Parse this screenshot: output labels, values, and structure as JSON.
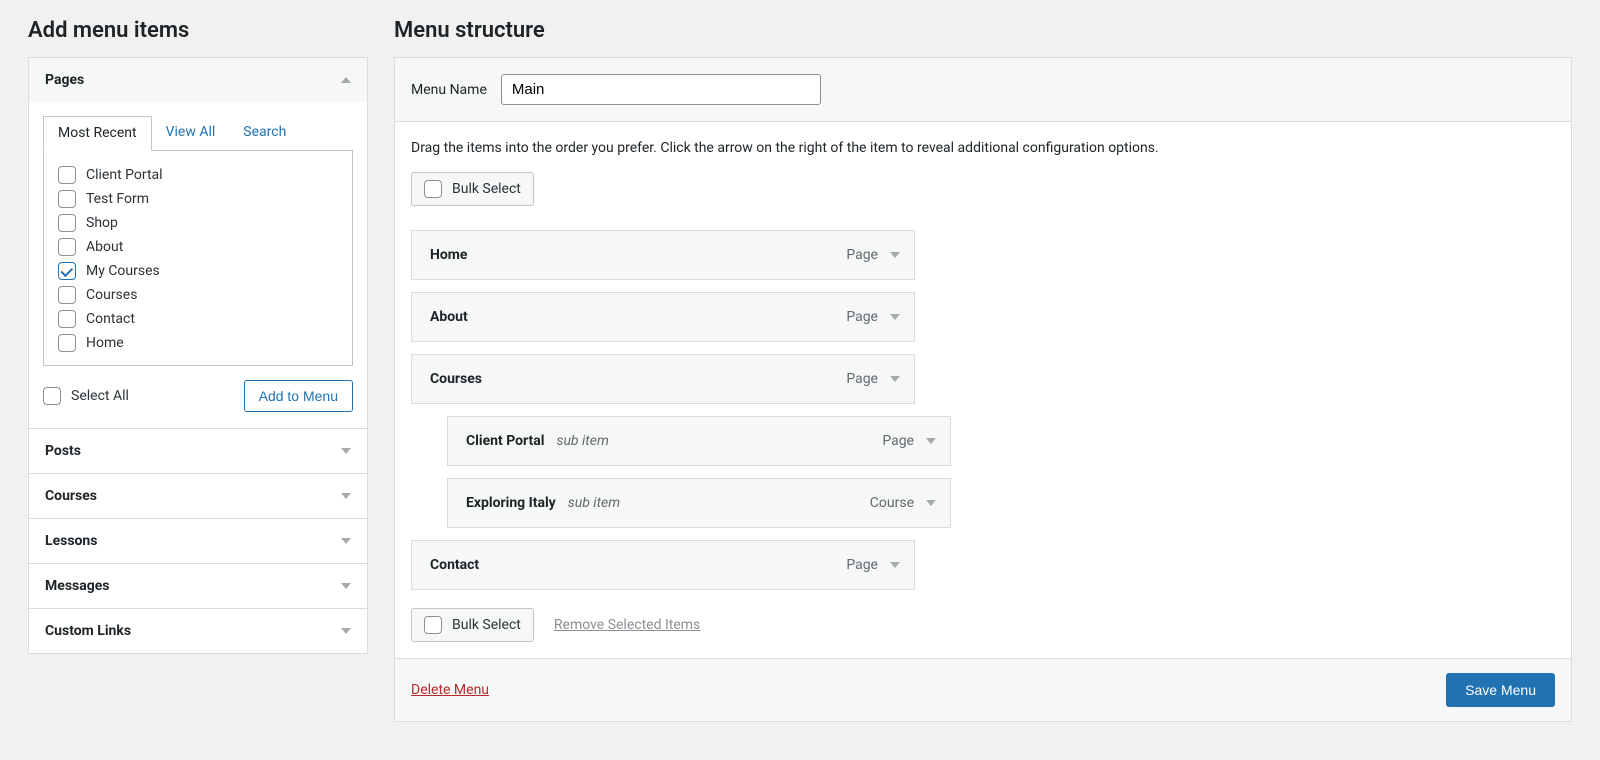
{
  "left": {
    "heading": "Add menu items",
    "sections": {
      "pages": {
        "title": "Pages",
        "tabs": {
          "recent": "Most Recent",
          "view_all": "View All",
          "search": "Search"
        },
        "items": [
          {
            "label": "Client Portal",
            "checked": false
          },
          {
            "label": "Test Form",
            "checked": false
          },
          {
            "label": "Shop",
            "checked": false
          },
          {
            "label": "About",
            "checked": false
          },
          {
            "label": "My Courses",
            "checked": true
          },
          {
            "label": "Courses",
            "checked": false
          },
          {
            "label": "Contact",
            "checked": false
          },
          {
            "label": "Home",
            "checked": false
          }
        ],
        "select_all": "Select All",
        "add_button": "Add to Menu"
      },
      "posts": "Posts",
      "courses": "Courses",
      "lessons": "Lessons",
      "messages": "Messages",
      "custom_links": "Custom Links"
    }
  },
  "right": {
    "heading": "Menu structure",
    "name_label": "Menu Name",
    "name_value": "Main",
    "hint": "Drag the items into the order you prefer. Click the arrow on the right of the item to reveal additional configuration options.",
    "bulk_label": "Bulk Select",
    "sub_label": "sub item",
    "items": [
      {
        "title": "Home",
        "type": "Page",
        "depth": 0
      },
      {
        "title": "About",
        "type": "Page",
        "depth": 0
      },
      {
        "title": "Courses",
        "type": "Page",
        "depth": 0
      },
      {
        "title": "Client Portal",
        "type": "Page",
        "depth": 1
      },
      {
        "title": "Exploring Italy",
        "type": "Course",
        "depth": 1
      },
      {
        "title": "Contact",
        "type": "Page",
        "depth": 0
      }
    ],
    "remove_selected": "Remove Selected Items",
    "delete_menu": "Delete Menu",
    "save_menu": "Save Menu"
  }
}
